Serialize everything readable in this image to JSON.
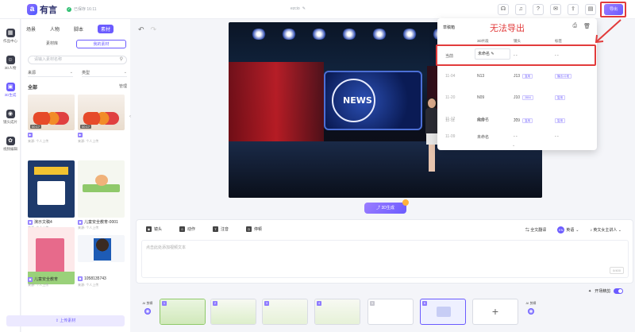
{
  "topbar": {
    "logo_mark": "a",
    "logo_text": "有言",
    "saved_status": "已保存 16:11",
    "doc_title": "ezcio",
    "export_label": "导出",
    "icons": [
      "headset-icon",
      "bell-icon",
      "help-icon",
      "mail-icon",
      "share-icon",
      "folder-icon"
    ]
  },
  "leftnav": {
    "items": [
      {
        "label": "作品中心",
        "icon": "grid-icon"
      },
      {
        "label": "3D人物",
        "icon": "avatar-icon"
      },
      {
        "label": "3D生成",
        "icon": "generate-icon"
      },
      {
        "label": "镜头成片",
        "icon": "camera-icon"
      },
      {
        "label": "视频编辑",
        "icon": "film-icon"
      }
    ]
  },
  "materials": {
    "tabs": [
      "场景",
      "人物",
      "脚本",
      "素材"
    ],
    "active_tab": "素材",
    "subtabs": [
      "素材库",
      "我的素材"
    ],
    "search_placeholder": "请输入素材名称",
    "filter_source": "来源",
    "filter_type": "类型",
    "all_label": "全部",
    "manage_label": "管理",
    "items": [
      {
        "duration": "00:17",
        "name": "",
        "sub": "来源: 个人上传"
      },
      {
        "duration": "00:17",
        "name": "",
        "sub": "来源: 个人上传"
      },
      {
        "duration": "",
        "name": "演示文稿4",
        "sub": "来源: 个人上传"
      },
      {
        "duration": "",
        "name": "儿童安全教育-0001",
        "sub": "来源: 个人上传"
      },
      {
        "duration": "",
        "name": "儿童安全教育",
        "sub": "来源: 个人上传"
      },
      {
        "duration": "",
        "name": "1058135743",
        "sub": "来源: 个人上传"
      }
    ],
    "upload_label": "上传素材"
  },
  "stage": {
    "news_text": "NEWS",
    "generate_3d_label": "3D生成"
  },
  "draft_popup": {
    "title": "草稿箱",
    "columns": [
      "",
      "3D片段",
      "镜头",
      "标签"
    ],
    "annotation": "无法导出",
    "rows": [
      {
        "date": "当前",
        "name": "未命名",
        "lens": "- -",
        "tag": "- -",
        "lens_tag": "",
        "tag_tag": ""
      },
      {
        "date": "11-04",
        "name": "N13",
        "lens": "J13",
        "tag": "- -",
        "lens_tag": "复用",
        "tag_tag": "播出-片段"
      },
      {
        "date": "11-20",
        "name": "N09",
        "lens": "J10",
        "tag": "- -",
        "lens_tag": "2804",
        "tag_tag": "复用"
      },
      {
        "date": "11-12",
        "name": "未命名",
        "lens": "- -",
        "tag": "- -",
        "lens_tag": "",
        "tag_tag": ""
      },
      {
        "date": "11-11",
        "name": "N09",
        "lens": "J09",
        "tag": "- -",
        "lens_tag": "复用",
        "tag_tag": "复用"
      },
      {
        "date": "11-09",
        "name": "未命名",
        "lens": "- -",
        "tag": "- -",
        "lens_tag": "",
        "tag_tag": ""
      }
    ]
  },
  "editor": {
    "tools": [
      "镜头",
      "动作",
      "注音",
      "停顿"
    ],
    "translate_label": "全文翻译",
    "language": "英语",
    "voice": "英文女主讲人",
    "placeholder": "点击此处添加视频文本",
    "counter": "0/400"
  },
  "timeline": {
    "ai_label": "AI 剪辑",
    "smart_label": "开场精剪",
    "clips": [
      "1",
      "2",
      "3",
      "4",
      "5",
      "6"
    ]
  },
  "colors": {
    "accent": "#6b5bff",
    "annotation_red": "#e23b3b"
  }
}
